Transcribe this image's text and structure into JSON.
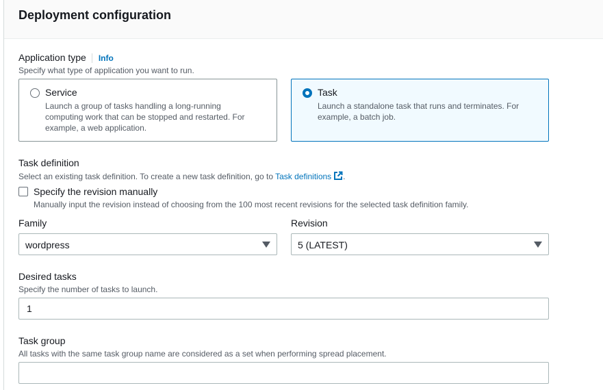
{
  "panel": {
    "title": "Deployment configuration"
  },
  "application_type": {
    "label": "Application type",
    "info": "Info",
    "description": "Specify what type of application you want to run.",
    "options": [
      {
        "label": "Service",
        "line1": "Launch a group of tasks handling a long-running",
        "line2": "computing work that can be stopped and restarted. For",
        "line3": "example, a web application.",
        "selected": false
      },
      {
        "label": "Task",
        "line1": "Launch a standalone task that runs and terminates. For",
        "line2": "example, a batch job.",
        "selected": true
      }
    ]
  },
  "task_definition": {
    "label": "Task definition",
    "description_prefix": "Select an existing task definition. To create a new task definition, go to",
    "link_text": "Task definitions",
    "description_suffix": ".",
    "manual_revision": {
      "label": "Specify the revision manually",
      "description": "Manually input the revision instead of choosing from the 100 most recent revisions for the selected task definition family.",
      "checked": false
    },
    "family": {
      "label": "Family",
      "value": "wordpress"
    },
    "revision": {
      "label": "Revision",
      "value": "5 (LATEST)"
    }
  },
  "desired_tasks": {
    "label": "Desired tasks",
    "description": "Specify the number of tasks to launch.",
    "value": "1"
  },
  "task_group": {
    "label": "Task group",
    "description": "All tasks with the same task group name are considered as a set when performing spread placement.",
    "value": ""
  },
  "colors": {
    "accent": "#0073bb",
    "selected_tile_bg": "#f1faff",
    "border": "#879596"
  },
  "icons": {
    "external_link": "external-link-icon",
    "caret": "caret-down-icon"
  }
}
